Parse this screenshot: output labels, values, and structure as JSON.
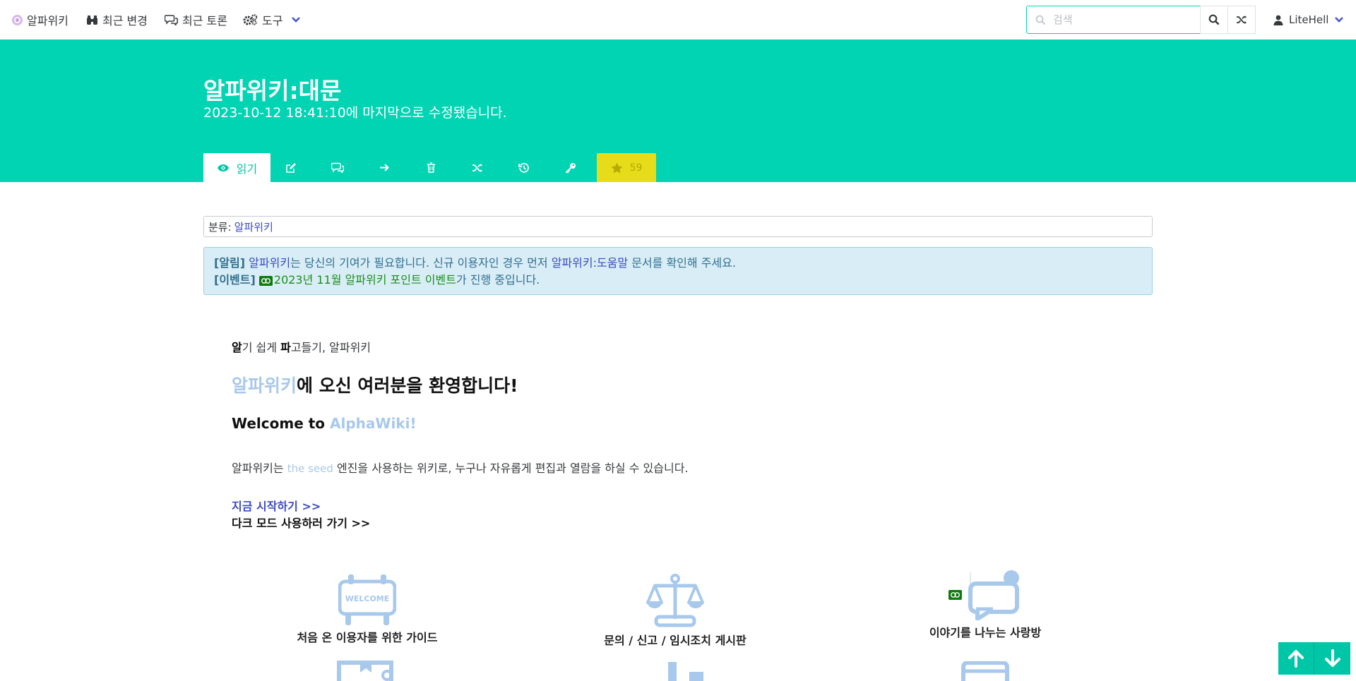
{
  "nav": {
    "site_name": "알파위키",
    "recent_changes": "최근 변경",
    "recent_discussions": "최근 토론",
    "tools": "도구",
    "search_placeholder": "검색",
    "username": "LiteHell"
  },
  "header": {
    "title": "알파위키:대문",
    "subtitle": "2023-10-12 18:41:10에 마지막으로 수정됐습니다.",
    "read_tab": "읽기",
    "star_count": "59"
  },
  "category": {
    "label": "분류:",
    "value": "알파위키"
  },
  "notice": {
    "alert_tag": "[알림]",
    "alert_link": "알파위키",
    "alert_mid": "는 당신의 기여가 필요합니다. 신규 이용자인 경우 먼저 ",
    "alert_help_link": "알파위키:도움말",
    "alert_end": " 문서를 확인해 주세요.",
    "event_tag": "[이벤트]",
    "event_link": "2023년 11월 알파위키 포인트 이벤트",
    "event_end": "가 진행 중입니다."
  },
  "main": {
    "motto_1b": "알",
    "motto_1": "기 쉽게 ",
    "motto_2b": "파",
    "motto_2": "고들기, 알파위키",
    "welcome_ko_link": "알파위키",
    "welcome_ko_rest": "에 오신 여러분을 환영합니다!",
    "welcome_en_pre": "Welcome to ",
    "welcome_en_link": "AlphaWiki!",
    "desc_pre": "알파위키는 ",
    "desc_seed": "the seed",
    "desc_post": " 엔진을 사용하는 위키로, 누구나 자유롭게 편집과 열람을 하실 수 있습니다.",
    "start_link": "지금 시작하기 >>",
    "dark_link": "다크 모드 사용하러 가기 >>"
  },
  "cards": [
    {
      "label": "처음 온 이용자를 위한 가이드",
      "icon": "welcome-sign-icon",
      "sign_text": "WELCOME"
    },
    {
      "label": "문의 / 신고 / 임시조치 게시판",
      "icon": "scales-icon"
    },
    {
      "label": "이야기를 나누는 사랑방",
      "icon": "chat-bubble-icon"
    }
  ],
  "colors": {
    "accent": "#00d4b3",
    "link": "#3b4bc2",
    "star_tab": "#e6dc1a",
    "notice_bg": "#d9edf7",
    "icon_blue": "#a8c8ec"
  }
}
